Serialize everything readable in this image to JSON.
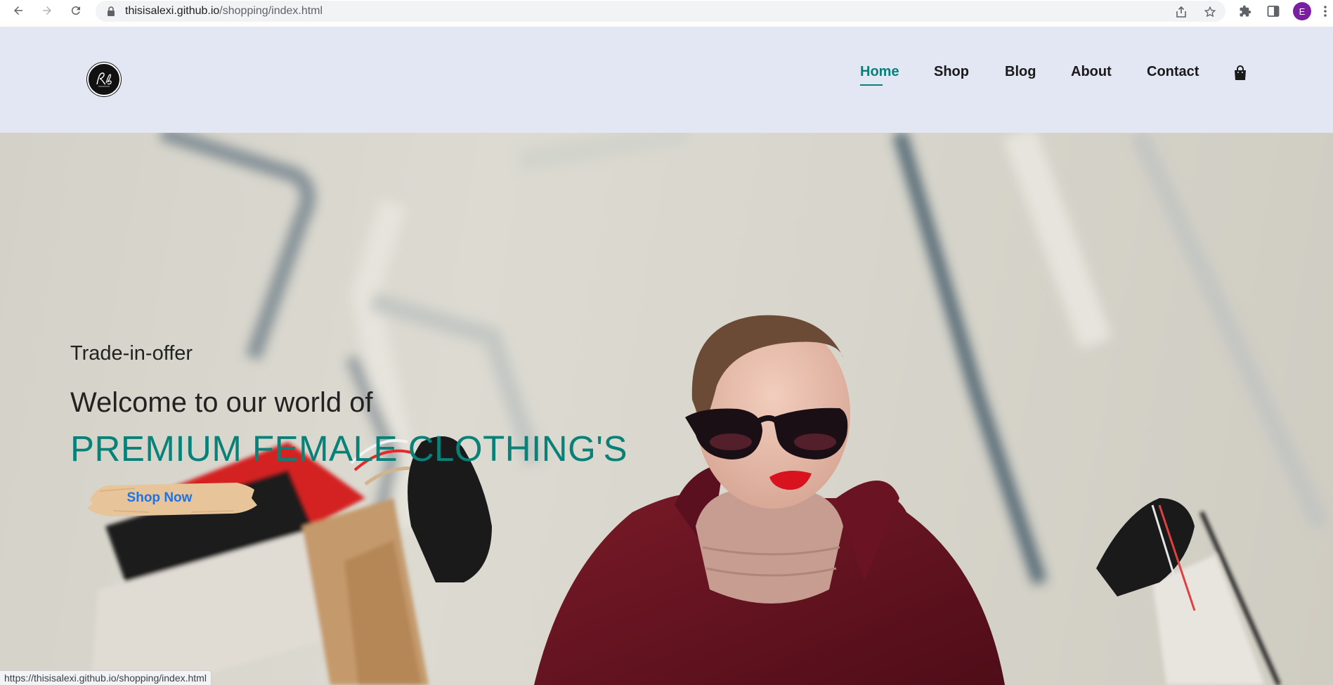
{
  "browser": {
    "url_host": "thisisalexi.github.io",
    "url_path": "/shopping/index.html",
    "profile_initial": "E",
    "status_url": "https://thisisalexi.github.io/shopping/index.html"
  },
  "nav": {
    "items": [
      {
        "label": "Home",
        "active": true
      },
      {
        "label": "Shop",
        "active": false
      },
      {
        "label": "Blog",
        "active": false
      },
      {
        "label": "About",
        "active": false
      },
      {
        "label": "Contact",
        "active": false
      }
    ],
    "cart_icon": "shopping-bag-icon"
  },
  "hero": {
    "offer": "Trade-in-offer",
    "welcome": "Welcome to our world of",
    "headline": "PREMIUM FEMALE CLOTHING'S",
    "cta": "Shop Now"
  },
  "colors": {
    "accent": "#088178",
    "header_bg": "#e3e6f3",
    "cta_brush": "#e8c49a",
    "cta_text": "#1a73e8",
    "coat": "#6e1522"
  }
}
